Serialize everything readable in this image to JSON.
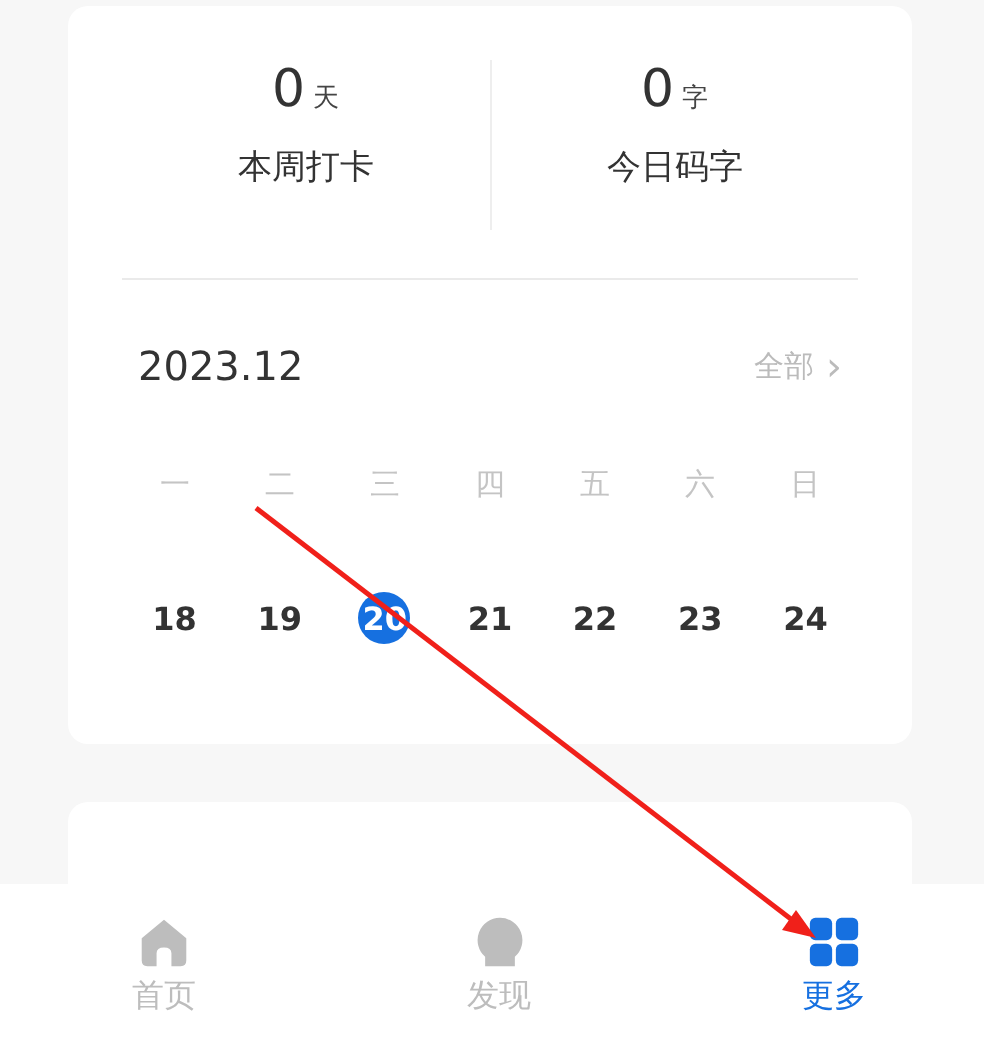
{
  "stats": [
    {
      "value": "0",
      "unit": "天",
      "label": "本周打卡"
    },
    {
      "value": "0",
      "unit": "字",
      "label": "今日码字"
    }
  ],
  "calendar": {
    "month": "2023.12",
    "all_link": "全部",
    "chevron": "›",
    "weekdays": [
      "一",
      "二",
      "三",
      "四",
      "五",
      "六",
      "日"
    ],
    "days": [
      {
        "label": "18",
        "selected": false
      },
      {
        "label": "19",
        "selected": false
      },
      {
        "label": "20",
        "selected": true
      },
      {
        "label": "21",
        "selected": false
      },
      {
        "label": "22",
        "selected": false
      },
      {
        "label": "23",
        "selected": false
      },
      {
        "label": "24",
        "selected": false
      }
    ]
  },
  "tabs": [
    {
      "kind": "home",
      "label": "首页",
      "selected": false
    },
    {
      "kind": "discover",
      "label": "发现",
      "selected": false
    },
    {
      "kind": "more",
      "label": "更多",
      "selected": true
    }
  ]
}
